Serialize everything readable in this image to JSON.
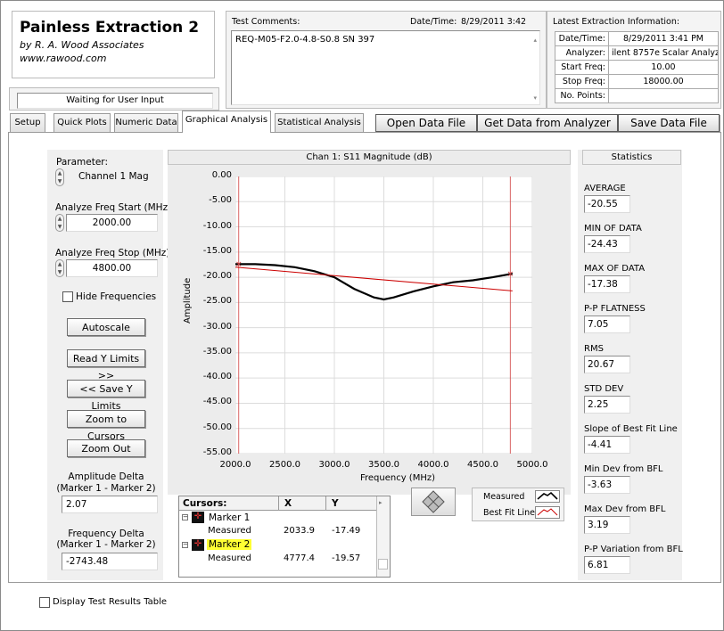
{
  "app": {
    "title": "Painless Extraction 2",
    "author": "by R. A. Wood Associates",
    "url": "www.rawood.com",
    "status": "Waiting for User Input"
  },
  "comments": {
    "label": "Test Comments:",
    "value": "REQ-M05-F2.0-4.8-S0.8 SN 397",
    "datetime_label": "Date/Time:",
    "datetime_value": "8/29/2011  3:42"
  },
  "extraction": {
    "title": "Latest Extraction Information:",
    "rows": [
      {
        "label": "Date/Time:",
        "value": "8/29/2011  3:41 PM"
      },
      {
        "label": "Analyzer:",
        "value": "ilent 8757e Scalar Analyz"
      },
      {
        "label": "Start Freq:",
        "value": "10.00"
      },
      {
        "label": "Stop Freq:",
        "value": "18000.00"
      },
      {
        "label": "No. Points:",
        "value": ""
      }
    ]
  },
  "tabs": [
    "Setup",
    "Quick Plots",
    "Numeric Data",
    "Graphical Analysis",
    "Statistical Analysis"
  ],
  "toolbar": {
    "open": "Open Data File",
    "get": "Get Data from Analyzer",
    "save": "Save Data File"
  },
  "left": {
    "parameter_label": "Parameter:",
    "parameter_value": "Channel 1 Mag",
    "start_label": "Analyze Freq Start (MHz)",
    "start_value": "2000.00",
    "stop_label": "Analyze Freq Stop (MHz)",
    "stop_value": "4800.00",
    "hide_freq": "Hide Frequencies",
    "autoscale": "Autoscale",
    "read_y": "Read Y Limits >>",
    "save_y": "<< Save Y Limits",
    "zoom_cursors": "Zoom to Cursors",
    "zoom_out": "Zoom Out",
    "amp_delta_label1": "Amplitude Delta",
    "amp_delta_label2": "(Marker 1 - Marker 2)",
    "amp_delta_value": "2.07",
    "freq_delta_label1": "Frequency Delta",
    "freq_delta_label2": "(Marker 1 - Marker 2)",
    "freq_delta_value": "-2743.48"
  },
  "cursors": {
    "headers": [
      "Cursors:",
      "X",
      "Y"
    ],
    "marker1": "Marker 1",
    "marker2": "Marker 2",
    "measured": "Measured",
    "m1_x": "2033.9",
    "m1_y": "-17.49",
    "m2_x": "4777.4",
    "m2_y": "-19.57"
  },
  "legend": {
    "measured": "Measured",
    "bestfit": "Best Fit Line"
  },
  "statistics": {
    "title": "Statistics",
    "items": [
      {
        "label": "AVERAGE",
        "value": "-20.55"
      },
      {
        "label": "MIN OF DATA",
        "value": "-24.43"
      },
      {
        "label": "MAX OF DATA",
        "value": "-17.38"
      },
      {
        "label": "P-P FLATNESS",
        "value": "7.05"
      },
      {
        "label": "RMS",
        "value": "20.67"
      },
      {
        "label": "STD DEV",
        "value": "2.25"
      },
      {
        "label": "Slope of Best Fit Line",
        "value": "-4.41"
      },
      {
        "label": "Min Dev from BFL",
        "value": "-3.63"
      },
      {
        "label": "Max Dev from BFL",
        "value": "3.19"
      },
      {
        "label": "P-P Variation from BFL",
        "value": "6.81"
      }
    ]
  },
  "footer": {
    "display_table": "Display Test Results Table"
  },
  "chart_data": {
    "type": "line",
    "title": "Chan 1: S11 Magnitude (dB)",
    "xlabel": "Frequency (MHz)",
    "ylabel": "Amplitude",
    "xlim": [
      2000,
      5000
    ],
    "ylim": [
      -55,
      0
    ],
    "x_ticks": [
      "2000.0",
      "2500.0",
      "3000.0",
      "3500.0",
      "4000.0",
      "4500.0",
      "5000.0"
    ],
    "y_ticks": [
      "0.00",
      "-5.00",
      "-10.00",
      "-15.00",
      "-20.00",
      "-25.00",
      "-30.00",
      "-35.00",
      "-40.00",
      "-45.00",
      "-50.00",
      "-55.00"
    ],
    "series": [
      {
        "name": "Measured",
        "color": "#000000",
        "x": [
          2000,
          2200,
          2400,
          2600,
          2800,
          3000,
          3200,
          3400,
          3500,
          3600,
          3800,
          4000,
          4200,
          4400,
          4600,
          4800
        ],
        "y": [
          -17.4,
          -17.4,
          -17.6,
          -18.0,
          -18.8,
          -20.0,
          -22.3,
          -24.0,
          -24.4,
          -24.0,
          -22.8,
          -21.8,
          -21.0,
          -20.6,
          -20.0,
          -19.3
        ]
      },
      {
        "name": "Best Fit Line",
        "color": "#cc0000",
        "x": [
          2000,
          4800
        ],
        "y": [
          -18.0,
          -22.7
        ]
      }
    ],
    "cursors_x": [
      2033.9,
      4777.4
    ]
  },
  "colors": {
    "highlight": "#ffff33",
    "plot_grid": "#dcdcdc"
  }
}
